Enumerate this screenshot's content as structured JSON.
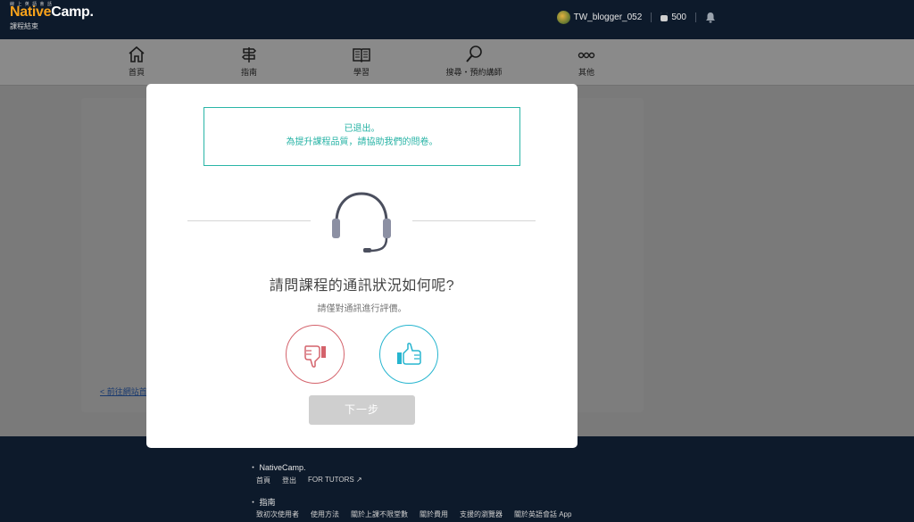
{
  "header": {
    "tagline": "線 上 英 語 會 話",
    "logo_part1": "Native",
    "logo_part2": "Camp.",
    "subtitle": "課程結束",
    "username": "TW_blogger_052",
    "coins": "500",
    "icons": [
      "avatar",
      "coin-icon",
      "bell-icon"
    ]
  },
  "nav": {
    "items": [
      {
        "label": "首頁",
        "icon": "home-icon"
      },
      {
        "label": "指南",
        "icon": "signpost-icon"
      },
      {
        "label": "學習",
        "icon": "book-icon"
      },
      {
        "label": "搜尋・預約講師",
        "icon": "search-icon"
      },
      {
        "label": "其他",
        "icon": "more-icon"
      }
    ]
  },
  "background": {
    "link_text": "< 前往網站首"
  },
  "modal": {
    "notice_line1": "已退出。",
    "notice_line2": "為提升課程品質，請協助我們的問卷。",
    "question": "請問課程的通訊狀況如何呢?",
    "subquestion": "請僅對通訊進行評價。",
    "next_label": "下一步",
    "colors": {
      "accent": "#2ab5a7",
      "down": "#d4626b",
      "up": "#26b5cf",
      "disabled": "#cfcfcf"
    }
  },
  "footer": {
    "section1_title": "・ NativeCamp.",
    "section1_links": [
      "首頁",
      "登出",
      "FOR TUTORS"
    ],
    "section2_title": "・ 指南",
    "section2_links": [
      "致初次使用者",
      "使用方法",
      "關於上課不限堂數",
      "關於費用",
      "支援的瀏覽器",
      "關於英語會話 App"
    ]
  }
}
